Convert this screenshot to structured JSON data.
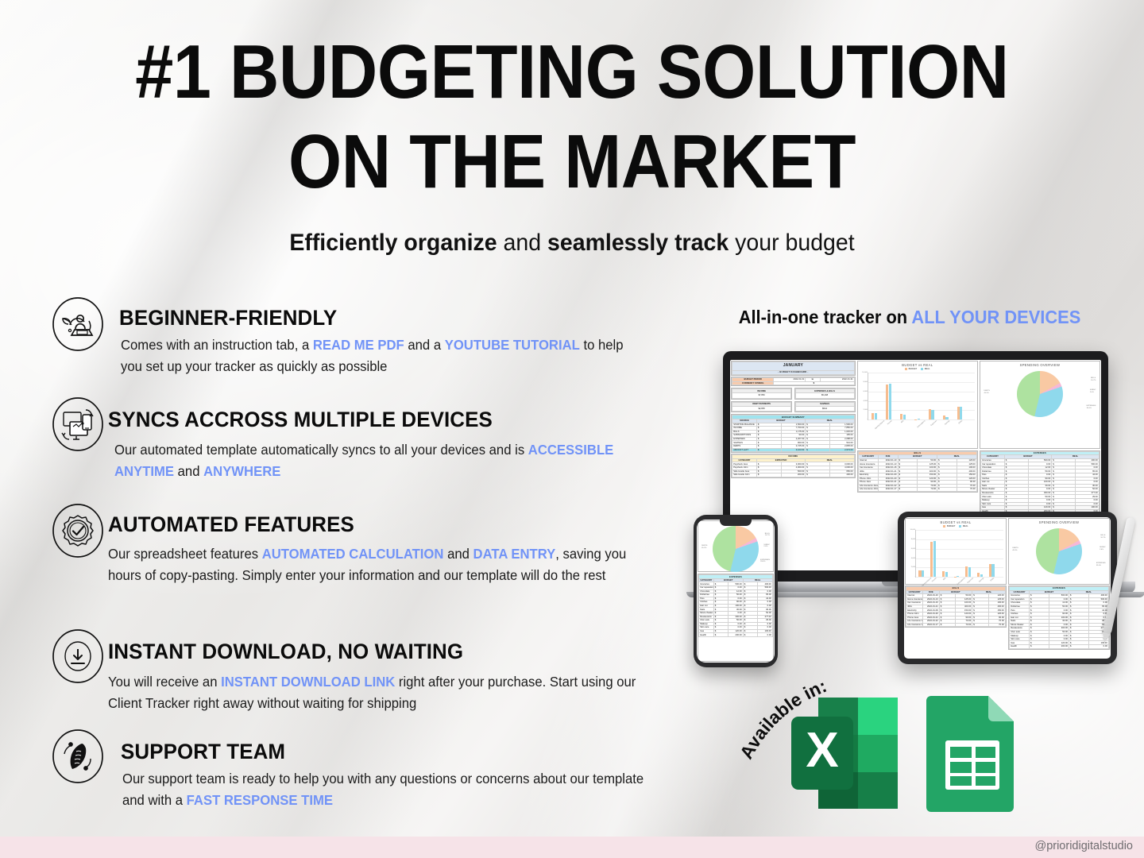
{
  "headline": {
    "line1": "#1 BUDGETING SOLUTION",
    "line2": "ON THE MARKET"
  },
  "subtitle": {
    "part1": "Efficiently organize",
    "part2": " and ",
    "part3": "seamlessly track",
    "part4": " your budget"
  },
  "colors": {
    "accent_blue": "#7193f7",
    "text_black": "#0b0b0b",
    "footer_pink": "#f6e3e8",
    "excel_green": "#1d7044",
    "sheets_green": "#23a566",
    "chart_budget": "#f7bd8f",
    "chart_real": "#8fd9ec"
  },
  "features": [
    {
      "icon": "person-laptop-leaf-icon",
      "title": "BEGINNER-FRIENDLY",
      "desc": [
        {
          "t": "Comes with an instruction tab, a ",
          "hl": false
        },
        {
          "t": "READ ME PDF",
          "hl": true
        },
        {
          "t": " and a ",
          "hl": false
        },
        {
          "t": "YOUTUBE TUTORIAL",
          "hl": true
        },
        {
          "t": " to help you set up your tracker as quickly as possible",
          "hl": false
        }
      ]
    },
    {
      "icon": "multi-device-sync-icon",
      "title": "SYNCS ACCROSS MULTIPLE DEVICES",
      "desc": [
        {
          "t": "Our automated template automatically syncs to all your devices and is ",
          "hl": false
        },
        {
          "t": "ACCESSIBLE ANYTIME",
          "hl": true
        },
        {
          "t": " and ",
          "hl": false
        },
        {
          "t": "ANYWHERE",
          "hl": true
        }
      ]
    },
    {
      "icon": "gear-checkmark-icon",
      "title": "AUTOMATED FEATURES",
      "desc": [
        {
          "t": "Our spreadsheet features ",
          "hl": false
        },
        {
          "t": "AUTOMATED CALCULATION",
          "hl": true
        },
        {
          "t": " and ",
          "hl": false
        },
        {
          "t": "DATA ENTRY",
          "hl": true
        },
        {
          "t": ", saving you hours of copy-pasting. Simply enter your information and our template will do the rest",
          "hl": false
        }
      ]
    },
    {
      "icon": "download-arrow-icon",
      "title": "INSTANT DOWNLOAD, NO WAITING",
      "desc": [
        {
          "t": "You will receive an ",
          "hl": false
        },
        {
          "t": "INSTANT DOWNLOAD LINK",
          "hl": true
        },
        {
          "t": " right after your purchase. Start using our Client Tracker right away without waiting for shipping",
          "hl": false
        }
      ]
    },
    {
      "icon": "support-hand-icon",
      "title": "SUPPORT TEAM",
      "desc": [
        {
          "t": "Our support team is ready to help you with any questions or concerns about our template and with a ",
          "hl": false
        },
        {
          "t": "FAST RESPONSE TIME",
          "hl": true
        }
      ]
    }
  ],
  "devices": {
    "title_plain": "All-in-one tracker on ",
    "title_accent": "ALL YOUR DEVICES"
  },
  "available": {
    "label": "Available in:",
    "logos": [
      "excel-logo",
      "google-sheets-logo"
    ]
  },
  "footer": {
    "handle": "@prioridigitalstudio"
  },
  "spreadsheet": {
    "month_title": "JANUARY",
    "month_subtitle": "- BUDGET DASHBOARD -",
    "period": {
      "label1": "BUDGET PERIOD",
      "label2": "CURRENCY SYMBOL",
      "from": "2022-01-01",
      "to_label": "to",
      "to": "2022-01-31",
      "symbol": "$"
    },
    "kpis": [
      {
        "label": "INCOME",
        "value": "$7,850"
      },
      {
        "label": "EXPENSES & BILLS",
        "value": "$5,498"
      },
      {
        "label": "DEBT PAYMENTS",
        "value": "$2,835"
      },
      {
        "label": "SAVINGS",
        "value": "$544"
      }
    ],
    "budget_summary": {
      "title": "BUDGET SUMMARY",
      "headers": [
        "SOURCE",
        "BUDGET",
        "REAL"
      ],
      "rows": [
        [
          "STARTING BALANCE",
          "1,500.00",
          "1,500.00"
        ],
        [
          "INCOME",
          "7,700.00",
          "7,850.00"
        ],
        [
          "BILLS",
          "1,175.00",
          "1,045.00"
        ],
        [
          "SUBSCRIPTIONS",
          "90.00",
          "165.00"
        ],
        [
          "EXPENSES",
          "2,207.00",
          "2,088.00"
        ],
        [
          "SAVINGS",
          "900.00",
          "544.00"
        ],
        [
          "DEBTS",
          "2,725.00",
          "2,835.00"
        ],
        [
          "AMOUNT LEFT",
          "3,103.00",
          "2,973.00"
        ]
      ]
    },
    "income": {
      "title": "INCOME",
      "headers": [
        "CATEGORY",
        "EXPECTED",
        "REAL"
      ],
      "rows": [
        [
          "Paycheck Jess",
          "3,000.00",
          "3,000.00"
        ],
        [
          "Paycheck John",
          "4,000.00",
          "4,000.00"
        ],
        [
          "Side Hustle Jess",
          "500.00",
          "650.00"
        ],
        [
          "Side Hustle John",
          "200.00",
          "400.00"
        ]
      ]
    },
    "bills": {
      "title": "BILLS",
      "headers": [
        "CATEGORY",
        "DUE",
        "BUDGET",
        "REAL"
      ],
      "rows": [
        [
          "Internet",
          "2022-01-10",
          "50.00",
          "120.00"
        ],
        [
          "Home insurance",
          "2022-01-13",
          "125.00",
          "125.00"
        ],
        [
          "Car insurance",
          "2022-01-16",
          "100.00",
          "100.00"
        ],
        [
          "401k",
          "2022-01-21",
          "400.00",
          "400.00"
        ],
        [
          "Electricity",
          "2022-01-09",
          "150.00",
          "150.00"
        ],
        [
          "Phone John",
          "2022-01-20",
          "120.00",
          "120.00"
        ],
        [
          "Phone Jess",
          "2022-01-21",
          "90.00",
          "90.00"
        ],
        [
          "Life insurance Jess",
          "2022-01-22",
          "70.00",
          "70.00"
        ],
        [
          "Life insurance John",
          "2022-01-17",
          "70.00",
          "70.00"
        ]
      ]
    },
    "expenses": {
      "title": "EXPENSES",
      "headers": [
        "CATEGORY",
        "BUDGET",
        "REAL"
      ],
      "rows": [
        [
          "Groceries",
          "500.00",
          "400.00"
        ],
        [
          "Car reparation",
          "0.00",
          "500.00"
        ],
        [
          "Chocolate",
          "12.00",
          "0.00"
        ],
        [
          "Dollartree",
          "50.00",
          "65.00"
        ],
        [
          "Pets",
          "0.00",
          "44.00"
        ],
        [
          "Clothes",
          "90.00",
          "0.00"
        ],
        [
          "Hair cut",
          "100.00",
          "0.00"
        ],
        [
          "Nails",
          "30.00",
          "30.00"
        ],
        [
          "Movie theater",
          "0.00",
          "52.00"
        ],
        [
          "Restaurants",
          "300.00",
          "277.00"
        ],
        [
          "Uber eats",
          "50.00",
          "29.00"
        ],
        [
          "Makeup",
          "0.00",
          "0.00"
        ],
        [
          "Skin care",
          "0.00",
          "0.00"
        ],
        [
          "Gas",
          "120.00",
          "100.00"
        ],
        [
          "Health",
          "200.00",
          "0.00"
        ]
      ]
    }
  },
  "chart_data": [
    {
      "type": "bar",
      "title": "BUDGET vs REAL",
      "categories": [
        "Starting balance",
        "Income",
        "Bills",
        "Subscriptions",
        "Expenses",
        "Savings",
        "Debts"
      ],
      "series": [
        {
          "name": "BUDGET",
          "values": [
            1500,
            7700,
            1175,
            90,
            2207,
            900,
            2725
          ]
        },
        {
          "name": "REAL",
          "values": [
            1500,
            7850,
            1045,
            165,
            2088,
            544,
            2835
          ]
        }
      ],
      "ylabel": "",
      "xlabel": "",
      "ylim": [
        0,
        10000
      ],
      "yticks": [
        "10,000",
        "8,000",
        "6,000",
        "4,000",
        "2,000",
        "-"
      ],
      "legend": "top",
      "grid": true
    },
    {
      "type": "pie",
      "title": "SPENDING OVERVIEW",
      "labels": [
        "BILLS",
        "SUBSC",
        "EXPENSES",
        "DEBTS"
      ],
      "values": [
        16.7,
        2.6,
        33.4,
        45.3
      ],
      "value_labels": [
        "16.7%",
        "2.6%",
        "33.4%",
        "45.3%"
      ],
      "colors": [
        "#f9c9a3",
        "#f6b8d8",
        "#8fd9ec",
        "#aee2a0"
      ],
      "legend": "callout"
    }
  ]
}
